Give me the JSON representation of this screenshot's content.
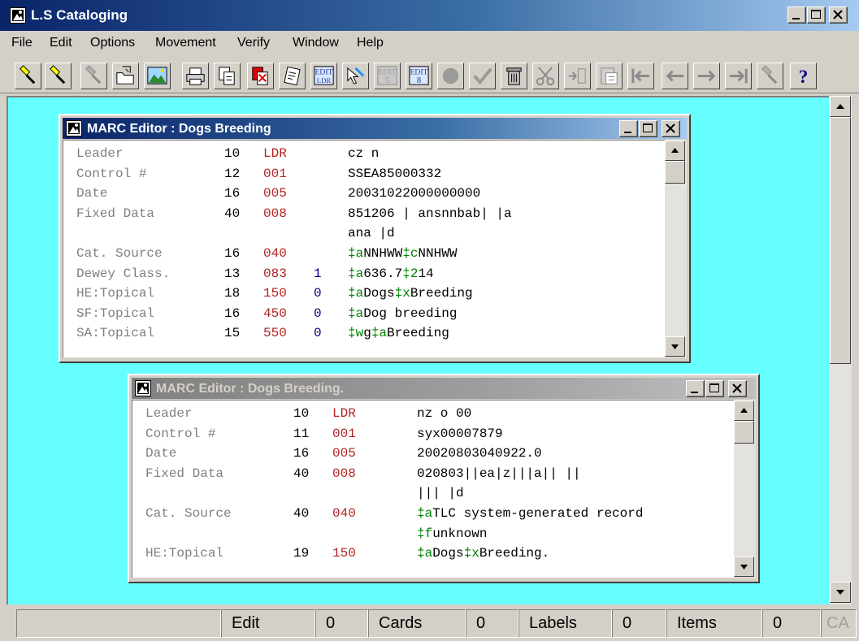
{
  "app": {
    "title": "L.S Cataloging"
  },
  "menu": [
    "File",
    "Edit",
    "Options",
    "Movement",
    "Verify",
    "Window",
    "Help"
  ],
  "toolbar": {
    "buttons": [
      {
        "name": "search-ls",
        "icon": "flashlight-icon",
        "enabled": true
      },
      {
        "name": "search-more",
        "icon": "flashlight-icon",
        "enabled": true
      },
      {
        "name": "search-disabled",
        "icon": "flashlight-icon",
        "enabled": false
      },
      {
        "name": "open-record",
        "icon": "folder-icon",
        "enabled": true
      },
      {
        "name": "image",
        "icon": "picture-icon",
        "enabled": true
      },
      {
        "name": "print",
        "icon": "printer-icon",
        "enabled": true
      },
      {
        "name": "copy-record",
        "icon": "copy-icon",
        "enabled": true
      },
      {
        "name": "delete-record",
        "icon": "delete-icon",
        "enabled": true
      },
      {
        "name": "note",
        "icon": "note-icon",
        "enabled": true
      },
      {
        "name": "edit-ldr",
        "icon": "edit-ldr-icon",
        "enabled": true,
        "lines": [
          "EDIT",
          "LDR"
        ]
      },
      {
        "name": "pointer",
        "icon": "pointer-icon",
        "enabled": true
      },
      {
        "name": "edit-5",
        "icon": "edit-5-icon",
        "enabled": false,
        "lines": [
          "EDIT",
          "5"
        ]
      },
      {
        "name": "edit-8",
        "icon": "edit-8-icon",
        "enabled": true,
        "lines": [
          "EDIT",
          "8"
        ]
      },
      {
        "name": "record",
        "icon": "circle-icon",
        "enabled": false
      },
      {
        "name": "verify",
        "icon": "checkmark-icon",
        "enabled": false
      },
      {
        "name": "trash",
        "icon": "trash-icon",
        "enabled": true
      },
      {
        "name": "cut",
        "icon": "scissors-icon",
        "enabled": false
      },
      {
        "name": "insert",
        "icon": "insert-icon",
        "enabled": false
      },
      {
        "name": "paste",
        "icon": "clipboard-icon",
        "enabled": false
      },
      {
        "name": "first",
        "icon": "first-icon",
        "enabled": false
      },
      {
        "name": "previous",
        "icon": "arrow-left-icon",
        "enabled": false
      },
      {
        "name": "next",
        "icon": "arrow-right-icon",
        "enabled": false
      },
      {
        "name": "last",
        "icon": "last-icon",
        "enabled": false
      },
      {
        "name": "search-global",
        "icon": "flashlight-icon",
        "enabled": false
      },
      {
        "name": "help",
        "icon": "help-icon",
        "enabled": true
      }
    ]
  },
  "editors": [
    {
      "title": "MARC Editor : Dogs Breeding",
      "active": true,
      "rows": [
        {
          "label": "Leader",
          "len": "10",
          "tag": "LDR",
          "ind": "",
          "segs": [
            {
              "t": "cz n"
            }
          ]
        },
        {
          "label": "Control #",
          "len": "12",
          "tag": "001",
          "ind": "",
          "segs": [
            {
              "t": "SSEA85000332"
            }
          ]
        },
        {
          "label": "Date",
          "len": "16",
          "tag": "005",
          "ind": "",
          "segs": [
            {
              "t": "20031022000000000"
            }
          ]
        },
        {
          "label": "Fixed Data",
          "len": "40",
          "tag": "008",
          "ind": "",
          "segs": [
            {
              "t": "851206 | ansnnbab|           |a"
            }
          ]
        },
        {
          "label": "",
          "len": "",
          "tag": "",
          "ind": "",
          "segs": [
            {
              "t": "ana    |d"
            }
          ]
        },
        {
          "label": "Cat. Source",
          "len": "16",
          "tag": "040",
          "ind": "",
          "segs": [
            {
              "t": "‡a",
              "sf": true
            },
            {
              "t": "NNHWW"
            },
            {
              "t": "‡c",
              "sf": true
            },
            {
              "t": "NNHWW"
            }
          ]
        },
        {
          "label": "Dewey Class.",
          "len": "13",
          "tag": "083",
          "ind": "1",
          "segs": [
            {
              "t": "‡a",
              "sf": true
            },
            {
              "t": "636.7"
            },
            {
              "t": "‡2",
              "sf": true
            },
            {
              "t": "14"
            }
          ]
        },
        {
          "label": "HE:Topical",
          "len": "18",
          "tag": "150",
          "ind": " 0",
          "segs": [
            {
              "t": "‡a",
              "sf": true
            },
            {
              "t": "Dogs"
            },
            {
              "t": "‡x",
              "sf": true
            },
            {
              "t": "Breeding"
            }
          ]
        },
        {
          "label": "SF:Topical",
          "len": "16",
          "tag": "450",
          "ind": " 0",
          "segs": [
            {
              "t": "‡a",
              "sf": true
            },
            {
              "t": "Dog breeding"
            }
          ]
        },
        {
          "label": "SA:Topical",
          "len": "15",
          "tag": "550",
          "ind": " 0",
          "segs": [
            {
              "t": "‡w",
              "sf": true
            },
            {
              "t": "g"
            },
            {
              "t": "‡a",
              "sf": true
            },
            {
              "t": "Breeding"
            }
          ]
        }
      ]
    },
    {
      "title": "MARC Editor : Dogs Breeding.",
      "active": false,
      "rows": [
        {
          "label": "Leader",
          "len": "10",
          "tag": "LDR",
          "ind": "",
          "segs": [
            {
              "t": "nz o    00"
            }
          ]
        },
        {
          "label": "Control #",
          "len": "11",
          "tag": "001",
          "ind": "",
          "segs": [
            {
              "t": "syx00007879"
            }
          ]
        },
        {
          "label": "Date",
          "len": "16",
          "tag": "005",
          "ind": "",
          "segs": [
            {
              "t": "20020803040922.0"
            }
          ]
        },
        {
          "label": "Fixed Data",
          "len": "40",
          "tag": "008",
          "ind": "",
          "segs": [
            {
              "t": "020803||ea|z|||a||           ||"
            }
          ]
        },
        {
          "label": "",
          "len": "",
          "tag": "",
          "ind": "",
          "segs": [
            {
              "t": "|||    |d"
            }
          ]
        },
        {
          "label": "Cat. Source",
          "len": "40",
          "tag": "040",
          "ind": "",
          "segs": [
            {
              "t": "‡a",
              "sf": true
            },
            {
              "t": "TLC system-generated record"
            }
          ]
        },
        {
          "label": "",
          "len": "",
          "tag": "",
          "ind": "",
          "segs": [
            {
              "t": "‡f",
              "sf": true
            },
            {
              "t": "unknown"
            }
          ]
        },
        {
          "label": "HE:Topical",
          "len": "19",
          "tag": "150",
          "ind": "",
          "segs": [
            {
              "t": "‡a",
              "sf": true
            },
            {
              "t": "Dogs"
            },
            {
              "t": "‡x",
              "sf": true
            },
            {
              "t": "Breeding."
            }
          ]
        }
      ]
    }
  ],
  "status": {
    "mode": "Edit",
    "edit_count": "0",
    "cards_label": "Cards",
    "cards_count": "0",
    "labels_label": "Labels",
    "labels_count": "0",
    "items_label": "Items",
    "items_count": "0",
    "caps": "CA"
  }
}
